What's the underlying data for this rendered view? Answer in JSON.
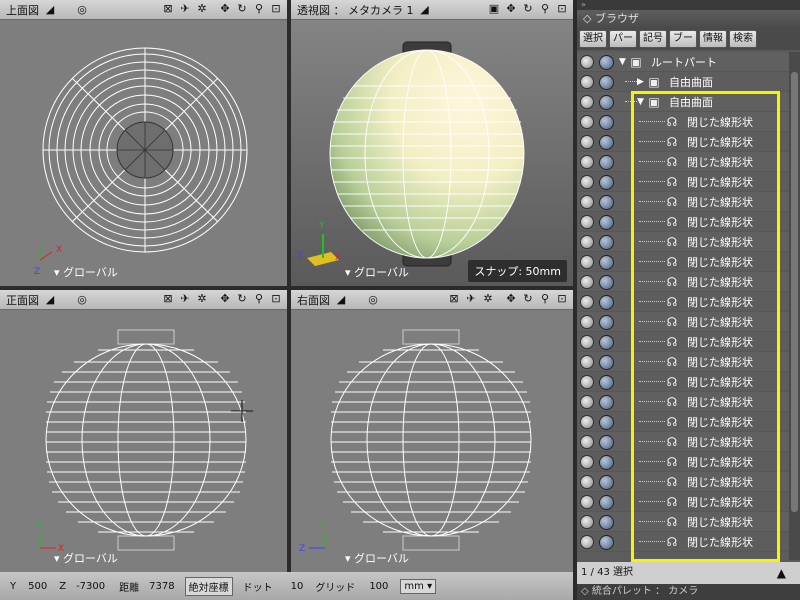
{
  "viewports": {
    "top": {
      "title": "上面図",
      "axis_mode": "グローバル"
    },
    "perspective": {
      "title": "透視図 ： メタカメラ 1",
      "axis_mode": "グローバル",
      "snap": "スナップ: 50mm"
    },
    "front": {
      "title": "正面図",
      "axis_mode": "グローバル"
    },
    "right": {
      "title": "右面図",
      "axis_mode": "グローバル"
    }
  },
  "toolbar_icons": [
    "record-icon",
    "cursor-icon",
    "tools-icon",
    "move-icon",
    "rotate-icon",
    "zoom-icon",
    "fit-icon"
  ],
  "status_bar": {
    "y_label": "Y",
    "y_value": "500",
    "z_label": "Z",
    "z_value": "-7300",
    "distance_label": "距離",
    "distance_value": "7378",
    "coord_mode": "絶対座標",
    "dot_label": "ドット",
    "dot_value": "10",
    "grid_label": "グリッド",
    "grid_value": "100",
    "unit": "mm"
  },
  "browser": {
    "title": "ブラウザ",
    "tabs": [
      "選択",
      "パー",
      "記号",
      "ブー",
      "情報",
      "検索"
    ],
    "tree": {
      "root": "ルートパート",
      "child1": "自由曲面",
      "child2": "自由曲面",
      "closed_line_label": "閉じた線形状",
      "closed_line_count": 22
    },
    "selection_count": "1 / 43 選択",
    "palette_title": "統合パレット ： カメラ"
  },
  "colors": {
    "highlight": "#f5f500",
    "viewport_bg": "#7e7e7e",
    "axis_x": "#e02020",
    "axis_y": "#20c020",
    "axis_z": "#4040ff"
  }
}
